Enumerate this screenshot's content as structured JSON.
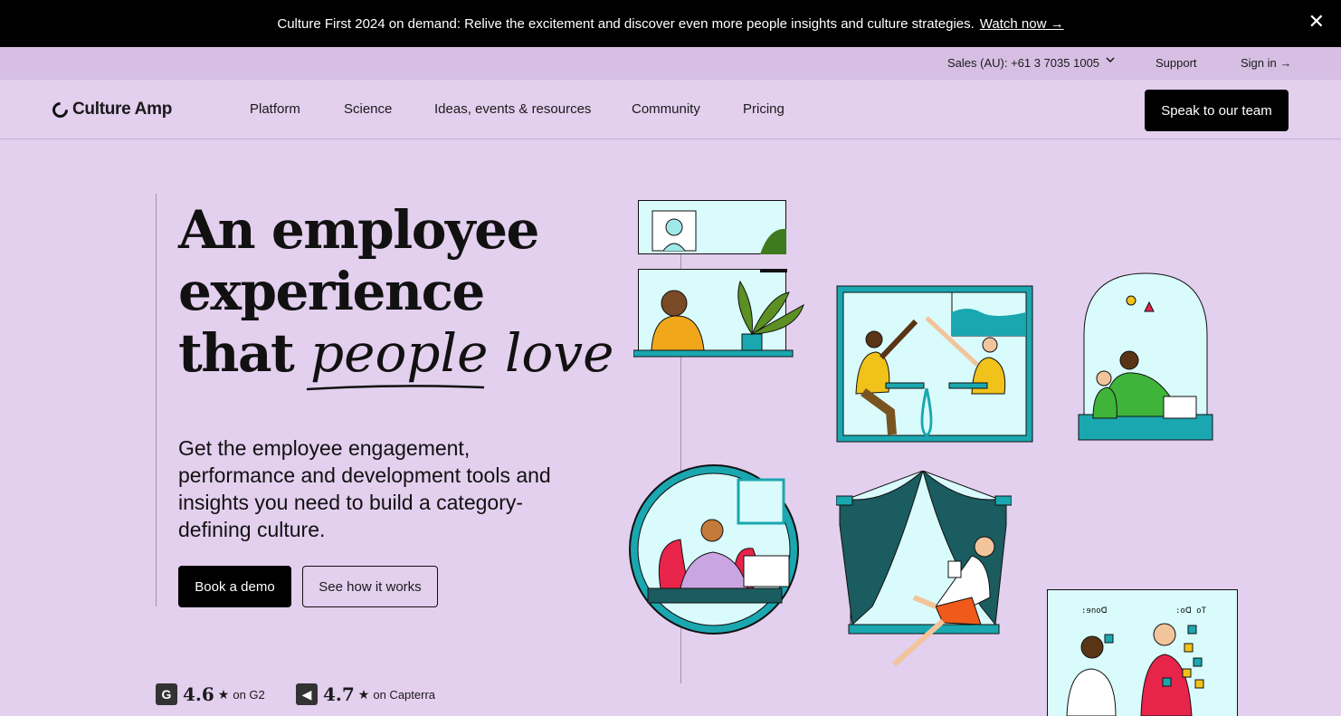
{
  "announcement": {
    "text": "Culture First 2024 on demand: Relive the excitement and discover even more people insights and culture strategies.",
    "link": "Watch now →",
    "close": "✕"
  },
  "utility": {
    "sales": "Sales (AU): +61 3 7035 1005",
    "support": "Support",
    "signin": "Sign in →"
  },
  "nav": {
    "logo": "Culture Amp",
    "links": [
      "Platform",
      "Science",
      "Ideas, events & resources",
      "Community",
      "Pricing"
    ],
    "cta": "Speak to our team"
  },
  "hero": {
    "line1": "An employee",
    "line2": "experience",
    "line3_prefix": "that",
    "line3_script": "people love",
    "subhead": "Get the employee engagement, performance and development tools and insights you need to build a category-defining culture.",
    "primary_button": "Book a demo",
    "secondary_button": "See how it works"
  },
  "ratings": [
    {
      "badge": "G",
      "score": "4.6",
      "star": "★",
      "source": "on G2"
    },
    {
      "badge": "◀",
      "score": "4.7",
      "star": "★",
      "source": "on Capterra"
    }
  ],
  "illustration": {
    "board_left_label": ":ɘnoᗡ",
    "board_right_label": ":oᗡ oT"
  },
  "colors": {
    "background": "#e3cfee",
    "utility_bar": "#d6bfe3",
    "teal": "#1aa7b0",
    "light_cyan": "#d9fbfb",
    "black": "#000000"
  }
}
